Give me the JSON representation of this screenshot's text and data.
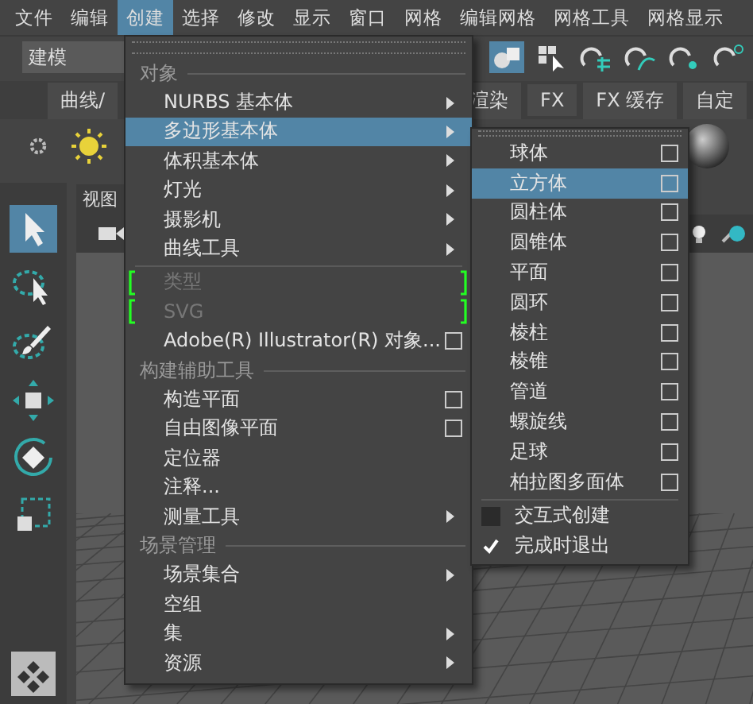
{
  "menubar": [
    {
      "label": "文件",
      "selected": false
    },
    {
      "label": "编辑",
      "selected": false
    },
    {
      "label": "创建",
      "selected": true
    },
    {
      "label": "选择",
      "selected": false
    },
    {
      "label": "修改",
      "selected": false
    },
    {
      "label": "显示",
      "selected": false
    },
    {
      "label": "窗口",
      "selected": false
    },
    {
      "label": "网格",
      "selected": false
    },
    {
      "label": "编辑网格",
      "selected": false
    },
    {
      "label": "网格工具",
      "selected": false
    },
    {
      "label": "网格显示",
      "selected": false
    }
  ],
  "workspace": {
    "value": "建模"
  },
  "shelf_tabs": [
    {
      "label": "曲线/",
      "selected": false
    },
    {
      "label": "渲染",
      "selected": false
    },
    {
      "label": "FX",
      "selected": false
    },
    {
      "label": "FX 缓存",
      "selected": false
    },
    {
      "label": "自定",
      "selected": false
    }
  ],
  "view_panel": {
    "tab": "视图"
  },
  "create_menu": {
    "items": [
      {
        "kind": "header",
        "label": "对象"
      },
      {
        "kind": "submenu",
        "label": "NURBS 基本体",
        "selected": false
      },
      {
        "kind": "submenu",
        "label": "多边形基本体",
        "selected": true
      },
      {
        "kind": "submenu",
        "label": "体积基本体",
        "selected": false
      },
      {
        "kind": "submenu",
        "label": "灯光",
        "selected": false
      },
      {
        "kind": "submenu",
        "label": "摄影机",
        "selected": false
      },
      {
        "kind": "submenu",
        "label": "曲线工具",
        "selected": false
      },
      {
        "kind": "disabled",
        "label": "类型",
        "selected": false
      },
      {
        "kind": "disabled",
        "label": "SVG",
        "selected": false
      },
      {
        "kind": "option",
        "label": "Adobe(R) Illustrator(R) 对象...",
        "selected": false
      },
      {
        "kind": "header",
        "label": "构建辅助工具"
      },
      {
        "kind": "option",
        "label": "构造平面",
        "selected": false
      },
      {
        "kind": "option",
        "label": "自由图像平面",
        "selected": false
      },
      {
        "kind": "action",
        "label": "定位器",
        "selected": false
      },
      {
        "kind": "action",
        "label": "注释...",
        "selected": false
      },
      {
        "kind": "submenu",
        "label": "测量工具",
        "selected": false
      },
      {
        "kind": "header",
        "label": "场景管理"
      },
      {
        "kind": "submenu",
        "label": "场景集合",
        "selected": false
      },
      {
        "kind": "action",
        "label": "空组",
        "selected": false
      },
      {
        "kind": "submenu",
        "label": "集",
        "selected": false
      },
      {
        "kind": "submenu",
        "label": "资源",
        "selected": false
      }
    ]
  },
  "polygon_submenu": {
    "items": [
      {
        "kind": "option",
        "label": "球体",
        "selected": false
      },
      {
        "kind": "option",
        "label": "立方体",
        "selected": true
      },
      {
        "kind": "option",
        "label": "圆柱体",
        "selected": false
      },
      {
        "kind": "option",
        "label": "圆锥体",
        "selected": false
      },
      {
        "kind": "option",
        "label": "平面",
        "selected": false
      },
      {
        "kind": "option",
        "label": "圆环",
        "selected": false
      },
      {
        "kind": "option",
        "label": "棱柱",
        "selected": false
      },
      {
        "kind": "option",
        "label": "棱锥",
        "selected": false
      },
      {
        "kind": "option",
        "label": "管道",
        "selected": false
      },
      {
        "kind": "option",
        "label": "螺旋线",
        "selected": false
      },
      {
        "kind": "option",
        "label": "足球",
        "selected": false
      },
      {
        "kind": "option",
        "label": "柏拉图多面体",
        "selected": false
      },
      {
        "kind": "check",
        "label": "交互式创建",
        "checked": false
      },
      {
        "kind": "check",
        "label": "完成时退出",
        "checked": true
      }
    ]
  }
}
